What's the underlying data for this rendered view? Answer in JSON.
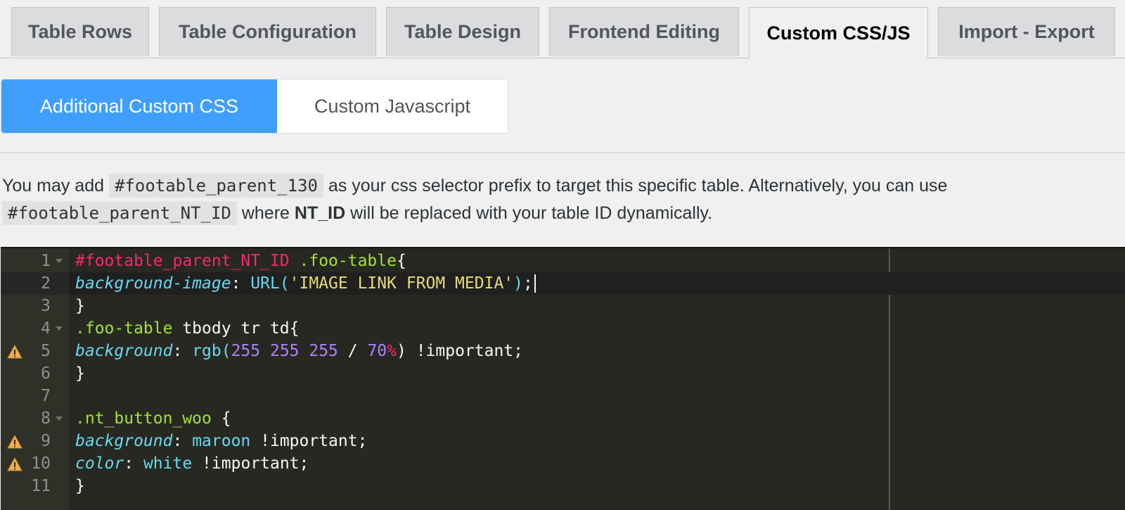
{
  "tabs": [
    {
      "label": "Table Rows",
      "active": false
    },
    {
      "label": "Table Configuration",
      "active": false
    },
    {
      "label": "Table Design",
      "active": false
    },
    {
      "label": "Frontend Editing",
      "active": false
    },
    {
      "label": "Custom CSS/JS",
      "active": true
    },
    {
      "label": "Import - Export",
      "active": false
    }
  ],
  "subtabs": [
    {
      "label": "Additional Custom CSS",
      "active": true
    },
    {
      "label": "Custom Javascript",
      "active": false
    }
  ],
  "help": {
    "part1": "You may add",
    "code1": "#footable_parent_130",
    "part2": "as your css selector prefix to target this specific table. Alternatively, you can use",
    "code2": "#footable_parent_NT_ID",
    "part3": "where",
    "bold": "NT_ID",
    "part4": "will be replaced with your table ID dynamically."
  },
  "editor": {
    "active_line": 2,
    "lines": [
      {
        "n": "1",
        "fold": true,
        "warn": false,
        "tokens": [
          [
            "sel-id",
            "#footable_parent_NT_ID"
          ],
          [
            "plain",
            " "
          ],
          [
            "sel-class",
            ".foo-table"
          ],
          [
            "plain",
            "{"
          ]
        ]
      },
      {
        "n": "2",
        "fold": false,
        "warn": false,
        "tokens": [
          [
            "prop",
            "background-image"
          ],
          [
            "plain",
            ": "
          ],
          [
            "fn",
            "URL("
          ],
          [
            "str",
            "'IMAGE LINK FROM MEDIA'"
          ],
          [
            "fn",
            ")"
          ],
          [
            "plain",
            ";"
          ]
        ]
      },
      {
        "n": "3",
        "fold": false,
        "warn": false,
        "tokens": [
          [
            "plain",
            "}"
          ]
        ]
      },
      {
        "n": "4",
        "fold": true,
        "warn": false,
        "tokens": [
          [
            "sel-class",
            ".foo-table"
          ],
          [
            "plain",
            " tbody tr td{"
          ]
        ]
      },
      {
        "n": "5",
        "fold": false,
        "warn": true,
        "tokens": [
          [
            "prop",
            "background"
          ],
          [
            "plain",
            ": "
          ],
          [
            "fn",
            "rgb("
          ],
          [
            "num",
            "255 255 255"
          ],
          [
            "plain",
            " / "
          ],
          [
            "num",
            "70"
          ],
          [
            "unit",
            "%"
          ],
          [
            "plain",
            ") !important;"
          ]
        ]
      },
      {
        "n": "6",
        "fold": false,
        "warn": false,
        "tokens": [
          [
            "plain",
            "}"
          ]
        ]
      },
      {
        "n": "7",
        "fold": false,
        "warn": false,
        "tokens": []
      },
      {
        "n": "8",
        "fold": true,
        "warn": false,
        "tokens": [
          [
            "sel-class",
            ".nt_button_woo"
          ],
          [
            "plain",
            " {"
          ]
        ]
      },
      {
        "n": "9",
        "fold": false,
        "warn": true,
        "tokens": [
          [
            "prop",
            "background"
          ],
          [
            "plain",
            ": "
          ],
          [
            "kw",
            "maroon"
          ],
          [
            "plain",
            " !important;"
          ]
        ]
      },
      {
        "n": "10",
        "fold": false,
        "warn": true,
        "tokens": [
          [
            "prop",
            "color"
          ],
          [
            "plain",
            ": "
          ],
          [
            "kw",
            "white"
          ],
          [
            "plain",
            " !important;"
          ]
        ]
      },
      {
        "n": "11",
        "fold": false,
        "warn": false,
        "tokens": [
          [
            "plain",
            "}"
          ]
        ]
      }
    ]
  },
  "colors": {
    "accent": "#409eff",
    "editor_bg": "#272822",
    "warning": "#f0ad4e"
  }
}
